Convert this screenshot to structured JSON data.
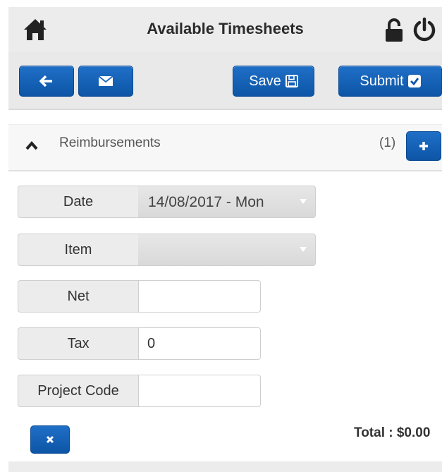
{
  "header": {
    "title": "Available Timesheets",
    "icons": [
      "home-icon",
      "lock-icon",
      "power-icon"
    ]
  },
  "toolbar": {
    "back_icon": "arrow-left-icon",
    "mail_icon": "envelope-icon",
    "save_label": "Save",
    "save_icon": "floppy-disk-icon",
    "submit_label": "Submit",
    "submit_icon": "checkbox-icon"
  },
  "section": {
    "label": "Reimbursements",
    "count": "(1)",
    "expand_icon": "chevron-up-icon",
    "add_icon": "plus-icon"
  },
  "form": {
    "date": {
      "label": "Date",
      "value": "14/08/2017 - Mon"
    },
    "item": {
      "label": "Item",
      "value": ""
    },
    "net": {
      "label": "Net",
      "value": ""
    },
    "tax": {
      "label": "Tax",
      "value": "0"
    },
    "project_code": {
      "label": "Project Code",
      "value": ""
    }
  },
  "footer": {
    "remove_icon": "close-icon",
    "total": "Total : $0.00"
  },
  "colors": {
    "accent": "#0d55a6",
    "header_bg": "#ececec"
  }
}
